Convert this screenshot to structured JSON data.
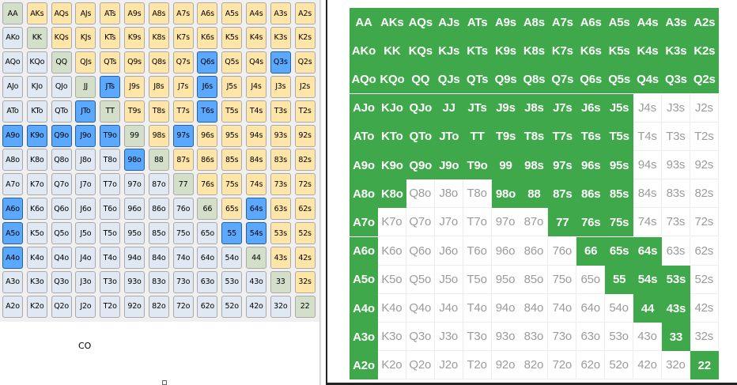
{
  "ranks": [
    "A",
    "K",
    "Q",
    "J",
    "T",
    "9",
    "8",
    "7",
    "6",
    "5",
    "4",
    "3",
    "2"
  ],
  "left_panel": {
    "position_label": "CO",
    "raise_hands": [
      "Q6s",
      "Q3s",
      "JTs",
      "J6s",
      "T6s",
      "JTo",
      "A9o",
      "K9o",
      "Q9o",
      "J9o",
      "T9o",
      "98o",
      "97s",
      "A6o",
      "64s",
      "A5o",
      "55",
      "54s",
      "A4o"
    ]
  },
  "right_panel": {
    "included_hands": [
      "AA",
      "AKs",
      "AQs",
      "AJs",
      "ATs",
      "A9s",
      "A8s",
      "A7s",
      "A6s",
      "A5s",
      "A4s",
      "A3s",
      "A2s",
      "AKo",
      "KK",
      "KQs",
      "KJs",
      "KTs",
      "K9s",
      "K8s",
      "K7s",
      "K6s",
      "K5s",
      "K4s",
      "K3s",
      "K2s",
      "AQo",
      "KQo",
      "QQ",
      "QJs",
      "QTs",
      "Q9s",
      "Q8s",
      "Q7s",
      "Q6s",
      "Q5s",
      "Q4s",
      "Q3s",
      "Q2s",
      "AJo",
      "KJo",
      "QJo",
      "JJ",
      "JTs",
      "J9s",
      "J8s",
      "J7s",
      "J6s",
      "J5s",
      "ATo",
      "KTo",
      "QTo",
      "JTo",
      "TT",
      "T9s",
      "T8s",
      "T7s",
      "T6s",
      "T5s",
      "A9o",
      "K9o",
      "Q9o",
      "J9o",
      "T9o",
      "99",
      "98s",
      "97s",
      "96s",
      "95s",
      "A8o",
      "K8o",
      "98o",
      "88",
      "87s",
      "86s",
      "85s",
      "A7o",
      "77",
      "76s",
      "75s",
      "A6o",
      "66",
      "65s",
      "64s",
      "A5o",
      "55",
      "54s",
      "53s",
      "A4o",
      "44",
      "43s",
      "A3o",
      "33",
      "A2o",
      "22"
    ]
  },
  "colors": {
    "left_pair": "#d3dfc9",
    "left_suited": "#ffe6a8",
    "left_offsuit": "#dfe8f3",
    "left_raise": "#5aa9ff",
    "right_included": "#3fa84a",
    "right_excluded_text": "#9b9b9b"
  }
}
